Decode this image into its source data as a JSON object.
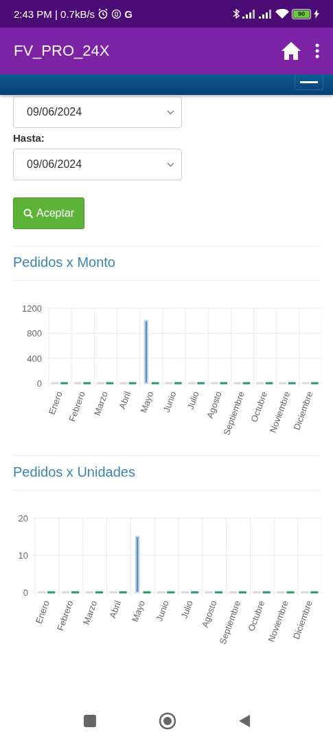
{
  "status_bar": {
    "time": "2:43 PM | 0.7kB/s",
    "notification_g": "G",
    "battery": "90"
  },
  "app_bar": {
    "title": "FV_PRO_24X"
  },
  "filters": [
    {
      "kind": "date",
      "value": "09/06/2024"
    },
    {
      "kind": "date",
      "label": "Hasta:",
      "value": "09/06/2024"
    }
  ],
  "accept_button": {
    "label": "Aceptar"
  },
  "charts": [
    {
      "title": "Pedidos x Monto",
      "chart_data": {
        "type": "bar",
        "categories": [
          "Enero",
          "Febrero",
          "Marzo",
          "Abril",
          "Mayo",
          "Junio",
          "Julio",
          "Agosto",
          "Septiembre",
          "Octubre",
          "Noviembre",
          "Diciembre"
        ],
        "series": [
          {
            "color": "#d8d8d8",
            "values": [
              0,
              0,
              0,
              0,
              null,
              0,
              0,
              0,
              0,
              0,
              0,
              0
            ]
          },
          {
            "color": "#5b8fbf",
            "values": [
              null,
              null,
              null,
              null,
              1000,
              null,
              null,
              null,
              null,
              null,
              null,
              null
            ]
          },
          {
            "color": "#1e9e62",
            "values": [
              0,
              0,
              0,
              0,
              0,
              0,
              0,
              0,
              0,
              0,
              0,
              0
            ]
          }
        ],
        "ylim": [
          0,
          1200
        ],
        "yticks": [
          0,
          400,
          800,
          1200
        ]
      }
    },
    {
      "title": "Pedidos x Unidades",
      "chart_data": {
        "type": "bar",
        "categories": [
          "Enero",
          "Febrero",
          "Marzo",
          "Abril",
          "Mayo",
          "Junio",
          "Julio",
          "Agosto",
          "Septiembre",
          "Octubre",
          "Noviembre",
          "Diciembre"
        ],
        "series": [
          {
            "color": "#d8d8d8",
            "values": [
              0,
              0,
              0,
              0,
              null,
              0,
              0,
              0,
              0,
              0,
              0,
              0
            ]
          },
          {
            "color": "#5b8fbf",
            "values": [
              null,
              null,
              null,
              null,
              15,
              null,
              null,
              null,
              null,
              null,
              null,
              null
            ]
          },
          {
            "color": "#1e9e62",
            "values": [
              0,
              0,
              0,
              0,
              0,
              0,
              0,
              0,
              0,
              0,
              0,
              0
            ]
          }
        ],
        "ylim": [
          0,
          20
        ],
        "yticks": [
          0,
          10,
          20
        ]
      }
    }
  ]
}
